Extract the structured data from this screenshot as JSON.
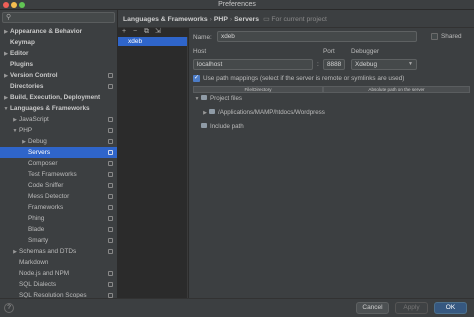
{
  "window": {
    "title": "Preferences"
  },
  "search": {
    "placeholder": ""
  },
  "sidebar": {
    "items": [
      {
        "label": "Appearance & Behavior",
        "arrow": "▶",
        "bold": true,
        "indent": 0,
        "proj": false
      },
      {
        "label": "Keymap",
        "arrow": "",
        "bold": true,
        "indent": 0,
        "proj": false
      },
      {
        "label": "Editor",
        "arrow": "▶",
        "bold": true,
        "indent": 0,
        "proj": false
      },
      {
        "label": "Plugins",
        "arrow": "",
        "bold": true,
        "indent": 0,
        "proj": false
      },
      {
        "label": "Version Control",
        "arrow": "▶",
        "bold": true,
        "indent": 0,
        "proj": true
      },
      {
        "label": "Directories",
        "arrow": "",
        "bold": true,
        "indent": 0,
        "proj": true
      },
      {
        "label": "Build, Execution, Deployment",
        "arrow": "▶",
        "bold": true,
        "indent": 0,
        "proj": false
      },
      {
        "label": "Languages & Frameworks",
        "arrow": "▼",
        "bold": true,
        "indent": 0,
        "proj": false
      },
      {
        "label": "JavaScript",
        "arrow": "▶",
        "bold": false,
        "indent": 1,
        "proj": true
      },
      {
        "label": "PHP",
        "arrow": "▼",
        "bold": false,
        "indent": 1,
        "proj": true
      },
      {
        "label": "Debug",
        "arrow": "▶",
        "bold": false,
        "indent": 2,
        "proj": true
      },
      {
        "label": "Servers",
        "arrow": "",
        "bold": false,
        "indent": 2,
        "proj": true,
        "selected": true
      },
      {
        "label": "Composer",
        "arrow": "",
        "bold": false,
        "indent": 2,
        "proj": true
      },
      {
        "label": "Test Frameworks",
        "arrow": "",
        "bold": false,
        "indent": 2,
        "proj": true
      },
      {
        "label": "Code Sniffer",
        "arrow": "",
        "bold": false,
        "indent": 2,
        "proj": true
      },
      {
        "label": "Mess Detector",
        "arrow": "",
        "bold": false,
        "indent": 2,
        "proj": true
      },
      {
        "label": "Frameworks",
        "arrow": "",
        "bold": false,
        "indent": 2,
        "proj": true
      },
      {
        "label": "Phing",
        "arrow": "",
        "bold": false,
        "indent": 2,
        "proj": true
      },
      {
        "label": "Blade",
        "arrow": "",
        "bold": false,
        "indent": 2,
        "proj": true
      },
      {
        "label": "Smarty",
        "arrow": "",
        "bold": false,
        "indent": 2,
        "proj": true
      },
      {
        "label": "Schemas and DTDs",
        "arrow": "▶",
        "bold": false,
        "indent": 1,
        "proj": true
      },
      {
        "label": "Markdown",
        "arrow": "",
        "bold": false,
        "indent": 1,
        "proj": false
      },
      {
        "label": "Node.js and NPM",
        "arrow": "",
        "bold": false,
        "indent": 1,
        "proj": true
      },
      {
        "label": "SQL Dialects",
        "arrow": "",
        "bold": false,
        "indent": 1,
        "proj": true
      },
      {
        "label": "SQL Resolution Scopes",
        "arrow": "",
        "bold": false,
        "indent": 1,
        "proj": true
      }
    ]
  },
  "header": {
    "crumbs": [
      "Languages & Frameworks",
      "PHP",
      "Servers"
    ],
    "sep": "›",
    "scope": "For current project"
  },
  "toolbar": {
    "add": "+",
    "remove": "−",
    "copy": "⧉",
    "import": "⇲"
  },
  "servers": [
    {
      "name": "xdeb"
    }
  ],
  "form": {
    "name_label": "Name:",
    "name_value": "xdeb",
    "shared_label": "Shared",
    "shared_checked": false,
    "host_label": "Host",
    "host_value": "localhost",
    "port_label": "Port",
    "port_value": "8888",
    "debugger_label": "Debugger",
    "debugger_value": "Xdebug",
    "mapping_checked": true,
    "mapping_label": "Use path mappings (select if the server is remote or symlinks are used)",
    "col_file": "File/Directory",
    "col_abs": "Absolute path on the server",
    "project_files": "Project files",
    "project_path": "/Applications/MAMP/htdocs/Wordpress",
    "include_path": "Include path"
  },
  "footer": {
    "cancel": "Cancel",
    "apply": "Apply",
    "ok": "OK",
    "help": "?"
  },
  "colors": {
    "selection": "#2f65ca",
    "primary_button": "#365880",
    "background": "#3c3f41"
  }
}
